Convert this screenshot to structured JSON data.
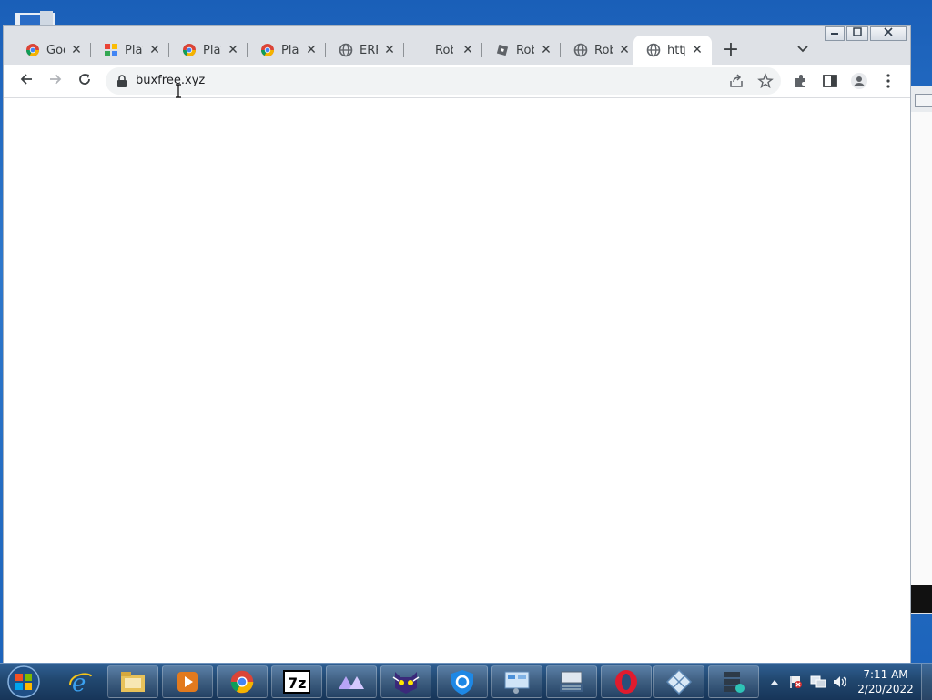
{
  "browser": {
    "tabs": [
      {
        "title": "Goo",
        "icon": "chrome-icon"
      },
      {
        "title": "Play",
        "icon": "play-grid-icon"
      },
      {
        "title": "Play",
        "icon": "chrome-icon"
      },
      {
        "title": "Play",
        "icon": "chrome-icon"
      },
      {
        "title": "ERR",
        "icon": "globe-icon"
      },
      {
        "title": "Rob",
        "icon": "blank-icon"
      },
      {
        "title": "Rob",
        "icon": "roblox-icon"
      },
      {
        "title": "Rob",
        "icon": "globe-icon"
      },
      {
        "title": "http",
        "icon": "globe-icon",
        "active": true
      }
    ],
    "new_tab_label": "+",
    "url": "buxfree.xyz",
    "close_glyph": "✕"
  },
  "taskbar": {
    "apps": [
      {
        "name": "internet-explorer"
      },
      {
        "name": "file-explorer"
      },
      {
        "name": "media-player"
      },
      {
        "name": "chrome"
      },
      {
        "name": "7zip"
      },
      {
        "name": "triangles-app"
      },
      {
        "name": "cat-app"
      },
      {
        "name": "shield-app"
      },
      {
        "name": "control-panel"
      },
      {
        "name": "keyboard-app"
      },
      {
        "name": "opera"
      },
      {
        "name": "diamond-app"
      },
      {
        "name": "server-app"
      }
    ],
    "clock": {
      "time": "7:11 AM",
      "date": "2/20/2022"
    }
  },
  "colors": {
    "tabstrip": "#dee1e6",
    "omnibox": "#f1f3f4",
    "desktop": "#1a5fb8",
    "taskbar": "#21476f"
  }
}
